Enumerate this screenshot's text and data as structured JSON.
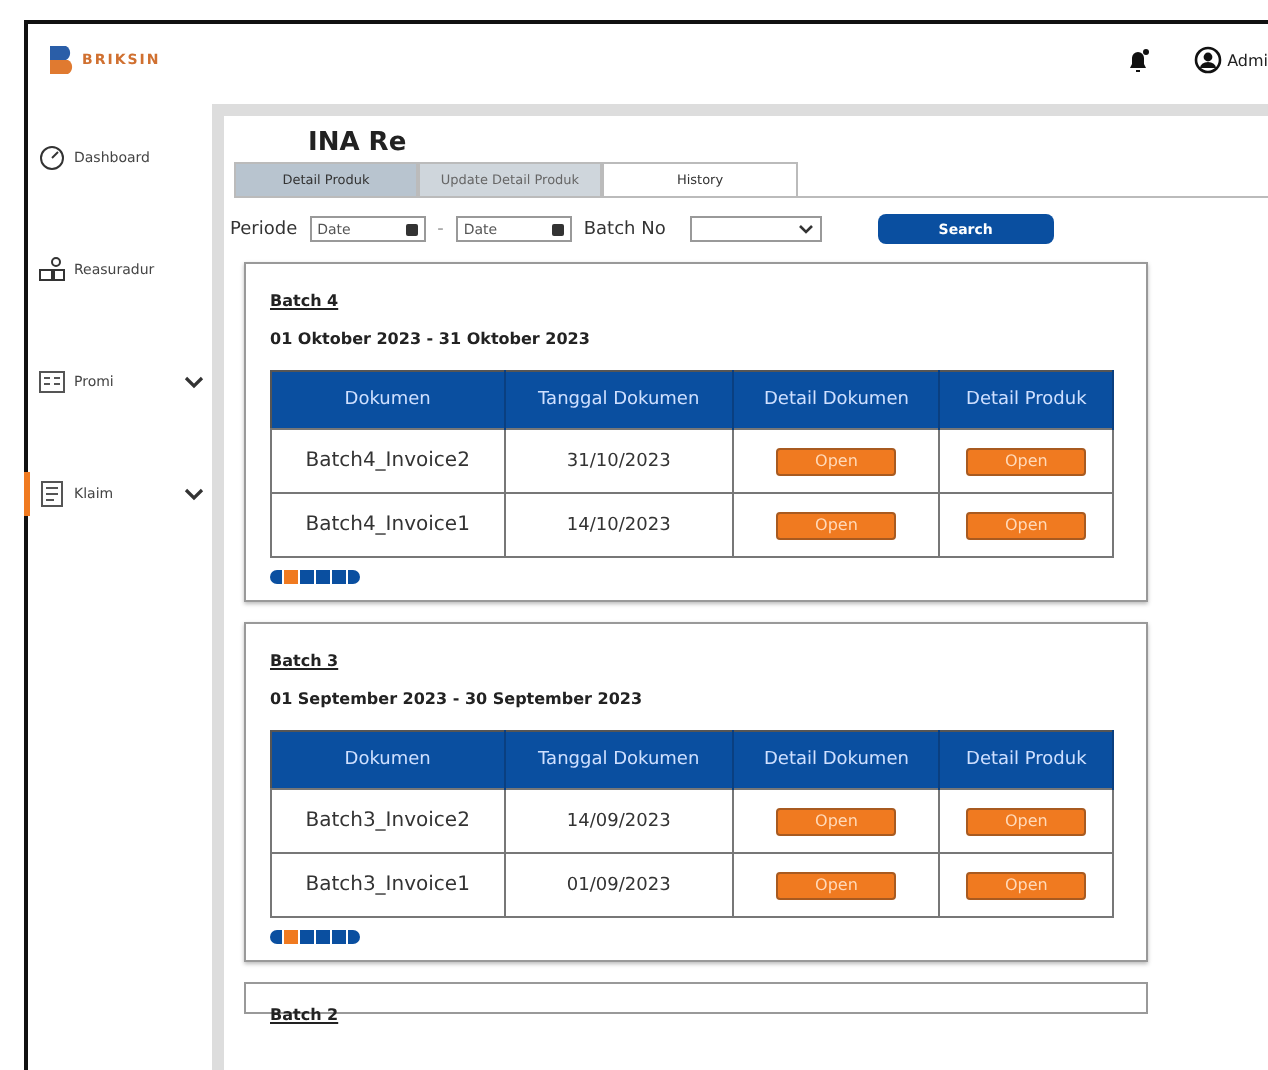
{
  "logo": {
    "text": "BRIKSIN"
  },
  "header": {
    "user": "Admi"
  },
  "sidebar": {
    "items": [
      {
        "label": "Dashboard",
        "expandable": false,
        "selected": false
      },
      {
        "label": "Reasuradur",
        "expandable": false,
        "selected": false
      },
      {
        "label": "Promi",
        "expandable": true,
        "selected": false
      },
      {
        "label": "Klaim",
        "expandable": true,
        "selected": true
      }
    ]
  },
  "page": {
    "title": "INA Re"
  },
  "tabs": [
    {
      "label": "Detail Produk",
      "selected": false
    },
    {
      "label": "Update Detail Produk",
      "selected": false
    },
    {
      "label": "History",
      "selected": true
    }
  ],
  "filter": {
    "label": "Periode",
    "from_placeholder": "Date",
    "separator": "-",
    "to_placeholder": "Date",
    "batch_label": "Batch No",
    "search_button": "Search"
  },
  "batches": [
    {
      "title": "Batch 4",
      "period": "01 Oktober 2023 - 31 Oktober 2023",
      "columns": [
        "Dokumen",
        "Tanggal Dokumen",
        "Detail Dokumen",
        "Detail Produk"
      ],
      "rows": [
        {
          "document": "Batch4_Invoice2",
          "date": "31/10/2023",
          "doc_button": "Open",
          "product_button": "Open"
        },
        {
          "document": "Batch4_Invoice1",
          "date": "14/10/2023",
          "doc_button": "Open",
          "product_button": "Open"
        }
      ],
      "pages": [
        {
          "selected": true
        },
        {
          "selected": false
        },
        {
          "selected": false
        },
        {
          "selected": false
        }
      ]
    },
    {
      "title": "Batch 3",
      "period": "01 September 2023 - 30 September 2023",
      "columns": [
        "Dokumen",
        "Tanggal Dokumen",
        "Detail Dokumen",
        "Detail Produk"
      ],
      "rows": [
        {
          "document": "Batch3_Invoice2",
          "date": "14/09/2023",
          "doc_button": "Open",
          "product_button": "Open"
        },
        {
          "document": "Batch3_Invoice1",
          "date": "01/09/2023",
          "doc_button": "Open",
          "product_button": "Open"
        }
      ],
      "pages": [
        {
          "selected": true
        },
        {
          "selected": false
        },
        {
          "selected": false
        },
        {
          "selected": false
        }
      ]
    },
    {
      "title": "Batch 2"
    }
  ]
}
